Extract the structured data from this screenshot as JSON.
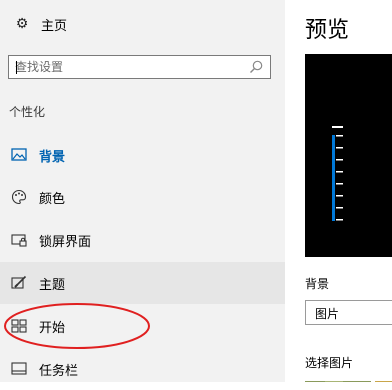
{
  "sidebar": {
    "home_label": "主页",
    "search": {
      "value": "",
      "placeholder": "查找设置"
    },
    "section_label": "个性化",
    "items": [
      {
        "label": "背景",
        "icon": "picture-icon",
        "state": "selected"
      },
      {
        "label": "颜色",
        "icon": "palette-icon",
        "state": "normal"
      },
      {
        "label": "锁屏界面",
        "icon": "lock-screen-icon",
        "state": "normal"
      },
      {
        "label": "主题",
        "icon": "theme-brush-icon",
        "state": "hover"
      },
      {
        "label": "开始",
        "icon": "start-tiles-icon",
        "state": "normal",
        "annotation": "red-circle"
      },
      {
        "label": "任务栏",
        "icon": "taskbar-icon",
        "state": "normal"
      }
    ]
  },
  "content": {
    "title": "预览",
    "background_label": "背景",
    "background_select": {
      "value": "图片"
    },
    "choose_picture_label": "选择图片"
  },
  "colors": {
    "accent": "#0063b1",
    "sidebar_bg": "#f2f2f2",
    "hover_bg": "#e6e6e6",
    "preview_bg": "#000000",
    "preview_tile": "#0078d7",
    "annotation_red": "#e02020"
  }
}
